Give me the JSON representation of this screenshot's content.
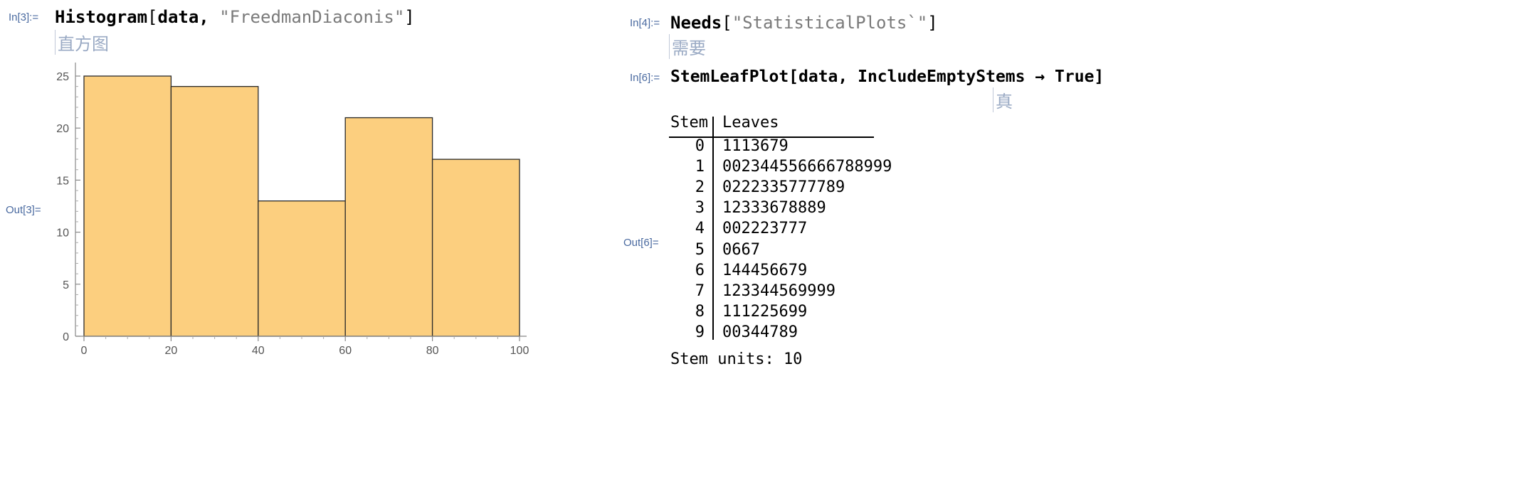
{
  "cells": {
    "in3_label": "In[3]:=",
    "in3_func": "Histogram",
    "in3_open": "[",
    "in3_arg": "data, ",
    "in3_str": "\"FreedmanDiaconis\"",
    "in3_close": "]",
    "in3_hint": "直方图",
    "out3_label": "Out[3]=",
    "in4_label": "In[4]:=",
    "in4_func": "Needs",
    "in4_open": "[",
    "in4_str": "\"StatisticalPlots`\"",
    "in4_close": "]",
    "in4_hint": "需要",
    "in6_label": "In[6]:=",
    "in6_code": "StemLeafPlot[data, IncludeEmptyStems → True]",
    "in6_hint": "真",
    "out6_label": "Out[6]="
  },
  "chart_data": {
    "type": "bar",
    "bins": [
      [
        0,
        20
      ],
      [
        20,
        40
      ],
      [
        40,
        60
      ],
      [
        60,
        80
      ],
      [
        80,
        100
      ]
    ],
    "values": [
      25,
      24,
      13,
      21,
      17
    ],
    "xlim": [
      0,
      100
    ],
    "ylim": [
      0,
      26
    ],
    "xticks": [
      "0",
      "20",
      "40",
      "60",
      "80",
      "100"
    ],
    "yticks": [
      "0",
      "5",
      "10",
      "15",
      "20",
      "25"
    ],
    "bar_color": "#fccf7f",
    "bar_edge": "#2a2a2a"
  },
  "stem_leaf": {
    "header_stem": "Stem",
    "header_leaves": "Leaves",
    "rows": [
      {
        "stem": "0",
        "leaves": "1113679"
      },
      {
        "stem": "1",
        "leaves": "002344556666788999"
      },
      {
        "stem": "2",
        "leaves": "0222335777789"
      },
      {
        "stem": "3",
        "leaves": "12333678889"
      },
      {
        "stem": "4",
        "leaves": "002223777"
      },
      {
        "stem": "5",
        "leaves": "0667"
      },
      {
        "stem": "6",
        "leaves": "144456679"
      },
      {
        "stem": "7",
        "leaves": "123344569999"
      },
      {
        "stem": "8",
        "leaves": "111225699"
      },
      {
        "stem": "9",
        "leaves": "00344789"
      }
    ],
    "units": "Stem units: 10"
  }
}
